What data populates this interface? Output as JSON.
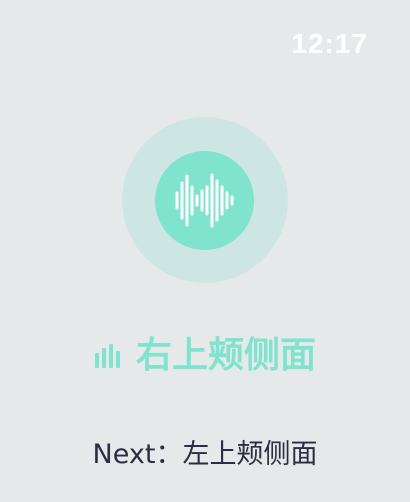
{
  "status_bar": {
    "time": "12:17"
  },
  "voice_indicator": {
    "outer_color": "#cde6e4",
    "inner_color": "#7fe3ce",
    "icon": "waveform-icon"
  },
  "current_exercise": {
    "icon": "audio-bars-icon",
    "label": "右上颊侧面",
    "color": "#7fe3ce"
  },
  "next_exercise": {
    "prefix": "Next：",
    "label": "左上颊侧面"
  }
}
